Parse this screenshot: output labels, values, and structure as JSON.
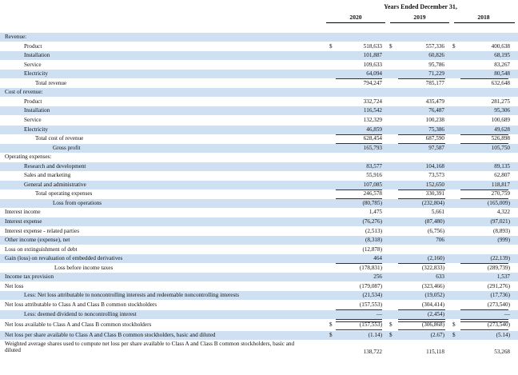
{
  "header": {
    "period": "Years Ended December 31,",
    "years": [
      "2020",
      "2019",
      "2018"
    ]
  },
  "currency": "$",
  "rows": [
    {
      "label": "Revenue:",
      "indent": 0,
      "values": [
        "",
        "",
        ""
      ]
    },
    {
      "label": "Product",
      "indent": 1,
      "values": [
        "518,633",
        "557,336",
        "400,638"
      ],
      "dollar": true
    },
    {
      "label": "Installation",
      "indent": 1,
      "values": [
        "101,887",
        "60,826",
        "68,195"
      ]
    },
    {
      "label": "Service",
      "indent": 1,
      "values": [
        "109,633",
        "95,786",
        "83,267"
      ]
    },
    {
      "label": "Electricity",
      "indent": 1,
      "values": [
        "64,094",
        "71,229",
        "80,548"
      ]
    },
    {
      "label": "Total revenue",
      "indent": 2,
      "values": [
        "794,247",
        "785,177",
        "632,648"
      ]
    },
    {
      "label": "Cost of revenue:",
      "indent": 0,
      "values": [
        "",
        "",
        ""
      ]
    },
    {
      "label": "Product",
      "indent": 1,
      "values": [
        "332,724",
        "435,479",
        "281,275"
      ]
    },
    {
      "label": "Installation",
      "indent": 1,
      "values": [
        "116,542",
        "76,487",
        "95,306"
      ]
    },
    {
      "label": "Service",
      "indent": 1,
      "values": [
        "132,329",
        "100,238",
        "100,689"
      ]
    },
    {
      "label": "Electricity",
      "indent": 1,
      "values": [
        "46,859",
        "75,386",
        "49,628"
      ]
    },
    {
      "label": "Total cost of revenue",
      "indent": 2,
      "values": [
        "628,454",
        "687,590",
        "526,898"
      ]
    },
    {
      "label": "Gross profit",
      "indent": 3,
      "values": [
        "165,793",
        "97,587",
        "105,750"
      ]
    },
    {
      "label": "Operating expenses:",
      "indent": 0,
      "values": [
        "",
        "",
        ""
      ]
    },
    {
      "label": "Research and development",
      "indent": 1,
      "values": [
        "83,577",
        "104,168",
        "89,135"
      ]
    },
    {
      "label": "Sales and marketing",
      "indent": 1,
      "values": [
        "55,916",
        "73,573",
        "62,807"
      ]
    },
    {
      "label": "General and administrative",
      "indent": 1,
      "values": [
        "107,085",
        "152,650",
        "118,817"
      ]
    },
    {
      "label": "Total operating expenses",
      "indent": 2,
      "values": [
        "246,578",
        "330,391",
        "270,759"
      ]
    },
    {
      "label": "Loss from operations",
      "indent": 3,
      "values": [
        "(80,785)",
        "(232,804)",
        "(165,009)"
      ]
    },
    {
      "label": "Interest income",
      "indent": 0,
      "values": [
        "1,475",
        "5,661",
        "4,322"
      ]
    },
    {
      "label": "Interest expense",
      "indent": 0,
      "values": [
        "(76,276)",
        "(87,480)",
        "(97,021)"
      ]
    },
    {
      "label": "Interest expense - related parties",
      "indent": 0,
      "values": [
        "(2,513)",
        "(6,756)",
        "(8,893)"
      ]
    },
    {
      "label": "Other income (expense), net",
      "indent": 0,
      "values": [
        "(8,318)",
        "706",
        "(999)"
      ]
    },
    {
      "label": "Loss on extinguishment of debt",
      "indent": 0,
      "values": [
        "(12,878)",
        "",
        ""
      ]
    },
    {
      "label": "Gain (loss) on revaluation of embedded derivatives",
      "indent": 0,
      "values": [
        "464",
        "(2,160)",
        "(22,139)"
      ]
    },
    {
      "label": "Loss before income taxes",
      "indent": 4,
      "values": [
        "(178,831)",
        "(322,833)",
        "(289,739)"
      ]
    },
    {
      "label": "Income tax provision",
      "indent": 0,
      "values": [
        "256",
        "633",
        "1,537"
      ]
    },
    {
      "label": "Net loss",
      "indent": 0,
      "values": [
        "(179,087)",
        "(323,466)",
        "(291,276)"
      ]
    },
    {
      "label": "Less: Net loss attributable to noncontrolling interests and redeemable noncontrolling interests",
      "indent": 1,
      "values": [
        "(21,534)",
        "(19,052)",
        "(17,736)"
      ]
    },
    {
      "label": "Net loss attributable to Class A and Class B common stockholders",
      "indent": 0,
      "values": [
        "(157,553)",
        "(304,414)",
        "(273,540)"
      ]
    },
    {
      "label": "Less: deemed dividend to noncontrolling interest",
      "indent": 1,
      "values": [
        "—",
        "(2,454)",
        "—"
      ]
    },
    {
      "label": "Net loss available to Class A and Class B common stockholders",
      "indent": 0,
      "values": [
        "(157,553)",
        "(306,868)",
        "(273,540)"
      ],
      "dollar": true
    },
    {
      "label": "Net loss per share available to Class A and Class B common stockholders, basic and diluted",
      "indent": 0,
      "values": [
        "(1.14)",
        "(2.67)",
        "(5.14)"
      ],
      "dollar": true
    },
    {
      "label": "Weighted average shares used to compute net loss per share available to Class A and Class B common stockholders, basic and diluted",
      "indent": 0,
      "values": [
        "138,722",
        "115,118",
        "53,268"
      ],
      "tall": true
    }
  ]
}
